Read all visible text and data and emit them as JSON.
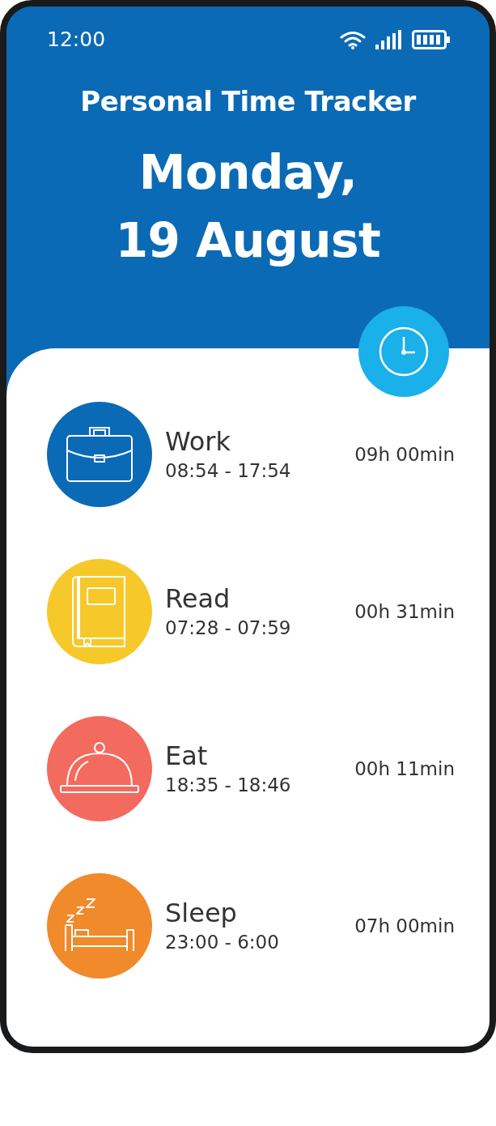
{
  "status_bar": {
    "time": "12:00"
  },
  "header": {
    "title": "Personal Time Tracker",
    "date_lines": [
      "Monday,",
      "19 August"
    ]
  },
  "activities": [
    {
      "kind": "work",
      "name": "Work",
      "time_range": "08:54 - 17:54",
      "duration": "09h 00min",
      "color": "#0b6ab5"
    },
    {
      "kind": "read",
      "name": "Read",
      "time_range": "07:28 - 07:59",
      "duration": "00h 31min",
      "color": "#f7c82a"
    },
    {
      "kind": "eat",
      "name": "Eat",
      "time_range": "18:35 - 18:46",
      "duration": "00h 11min",
      "color": "#f26b5e"
    },
    {
      "kind": "sleep",
      "name": "Sleep",
      "time_range": "23:00 - 6:00",
      "duration": "07h 00min",
      "color": "#f08a2a"
    }
  ]
}
